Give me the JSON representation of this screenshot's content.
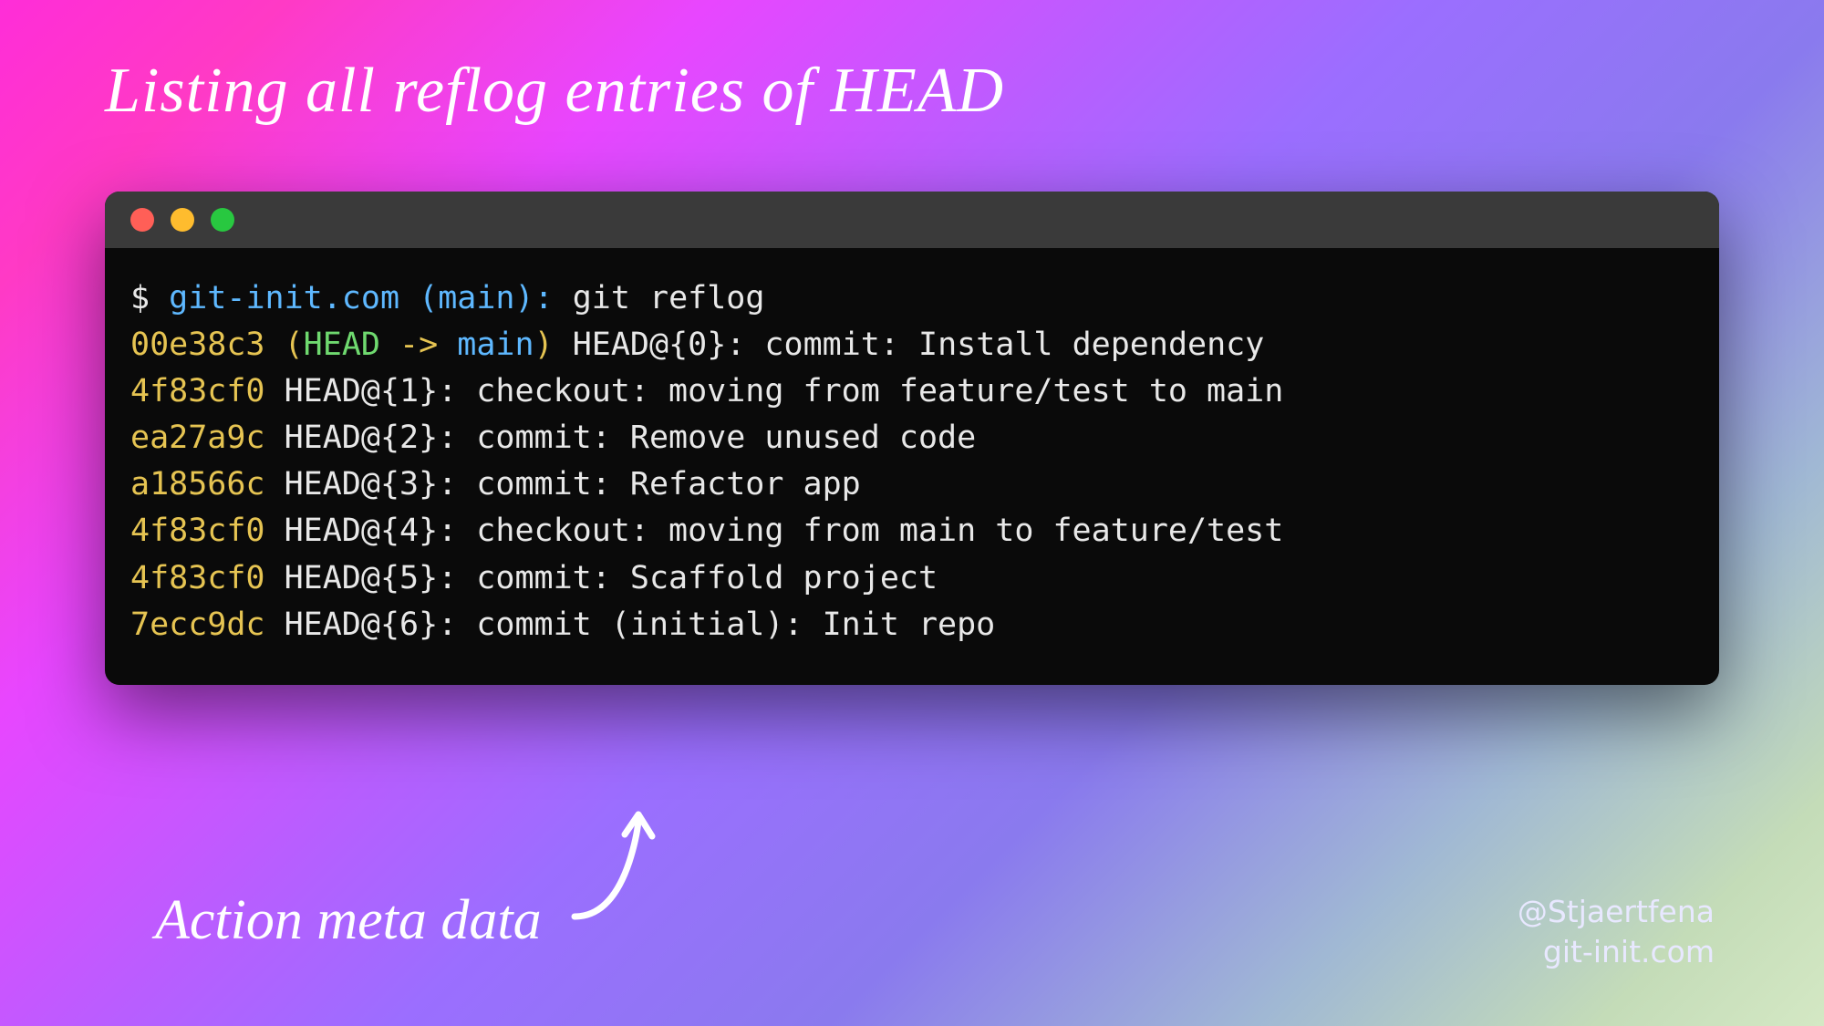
{
  "title": "Listing all reflog entries of HEAD",
  "prompt": {
    "dollar": "$",
    "host": "git-init.com",
    "branch_open": "(",
    "branch": "main",
    "branch_close": ")",
    "colon": ":",
    "command": "git reflog"
  },
  "reflog": [
    {
      "hash": "00e38c3",
      "decorated": true,
      "head": "HEAD",
      "arrow": " -> ",
      "branch": "main",
      "rest": " HEAD@{0}: commit: Install dependency"
    },
    {
      "hash": "4f83cf0",
      "decorated": false,
      "rest": " HEAD@{1}: checkout: moving from feature/test to main"
    },
    {
      "hash": "ea27a9c",
      "decorated": false,
      "rest": " HEAD@{2}: commit: Remove unused code"
    },
    {
      "hash": "a18566c",
      "decorated": false,
      "rest": " HEAD@{3}: commit: Refactor app"
    },
    {
      "hash": "4f83cf0",
      "decorated": false,
      "rest": " HEAD@{4}: checkout: moving from main to feature/test"
    },
    {
      "hash": "4f83cf0",
      "decorated": false,
      "rest": " HEAD@{5}: commit: Scaffold project"
    },
    {
      "hash": "7ecc9dc",
      "decorated": false,
      "rest": " HEAD@{6}: commit (initial): Init repo"
    }
  ],
  "annotation": "Action meta data",
  "credits": {
    "handle": "@Stjaertfena",
    "site": "git-init.com"
  },
  "colors": {
    "hash": "#e6c452",
    "head": "#6fd96f",
    "branch": "#5eb8ff",
    "text": "#e8e8e8",
    "terminal_bg": "#0a0a0a",
    "titlebar_bg": "#3a3a3a"
  }
}
